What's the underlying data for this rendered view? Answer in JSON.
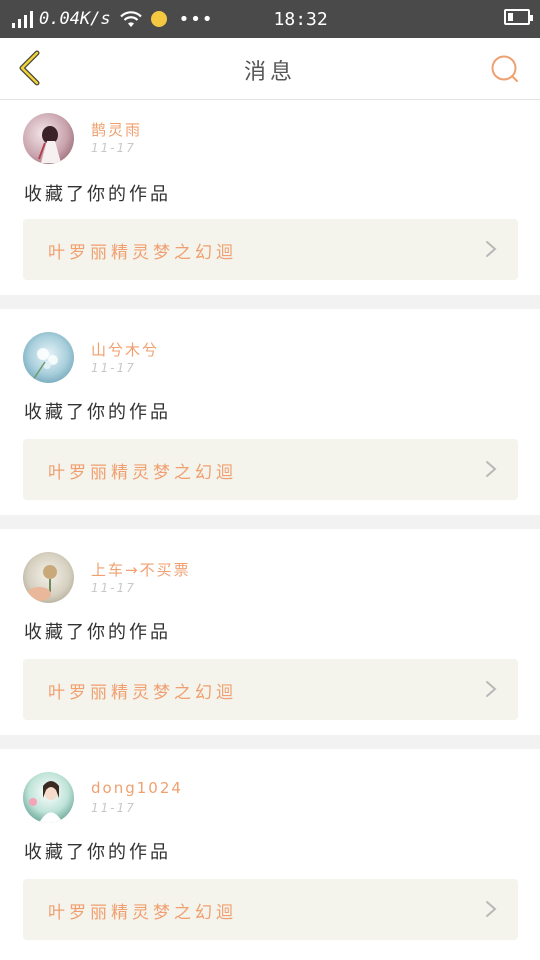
{
  "status_bar": {
    "net_speed": "0.04K/s",
    "time": "18:32"
  },
  "header": {
    "title": "消息",
    "back_icon": "chevron-left-icon",
    "search_icon": "search-icon",
    "accent_color": "#f0a070"
  },
  "messages": [
    {
      "user": "鹊灵雨",
      "time": "11-17",
      "action": "收藏了你的作品",
      "work_title": "叶罗丽精灵梦之幻迴"
    },
    {
      "user": "山兮木兮",
      "time": "11-17",
      "action": "收藏了你的作品",
      "work_title": "叶罗丽精灵梦之幻迴"
    },
    {
      "user": "上车→不买票",
      "time": "11-17",
      "action": "收藏了你的作品",
      "work_title": "叶罗丽精灵梦之幻迴"
    },
    {
      "user": "dong1024",
      "time": "11-17",
      "action": "收藏了你的作品",
      "work_title": "叶罗丽精灵梦之幻迴"
    }
  ]
}
